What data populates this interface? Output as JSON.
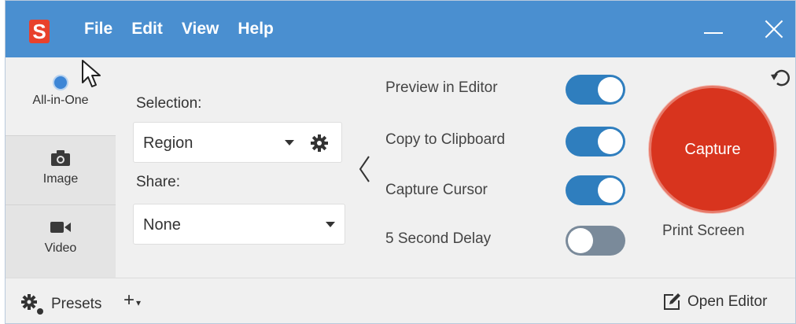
{
  "app": {
    "logo_letter": "S"
  },
  "menu": [
    "File",
    "Edit",
    "View",
    "Help"
  ],
  "tabs": [
    {
      "label": "All-in-One",
      "icon": "radio-selected-icon",
      "selected": true
    },
    {
      "label": "Image",
      "icon": "camera-icon",
      "selected": false
    },
    {
      "label": "Video",
      "icon": "video-camera-icon",
      "selected": false
    }
  ],
  "selection": {
    "label": "Selection:",
    "value": "Region"
  },
  "share": {
    "label": "Share:",
    "value": "None"
  },
  "options": [
    {
      "label": "Preview in Editor",
      "on": true
    },
    {
      "label": "Copy to Clipboard",
      "on": true
    },
    {
      "label": "Capture Cursor",
      "on": true
    },
    {
      "label": "5 Second Delay",
      "on": false
    }
  ],
  "capture": {
    "label": "Capture",
    "hotkey": "Print Screen"
  },
  "footer": {
    "presets_label": "Presets",
    "add_label": "+",
    "open_editor_label": "Open Editor"
  },
  "colors": {
    "titlebar": "#4a8fd0",
    "accent": "#2f7ebe",
    "capture": "#d8341e",
    "logo": "#e8412c"
  }
}
